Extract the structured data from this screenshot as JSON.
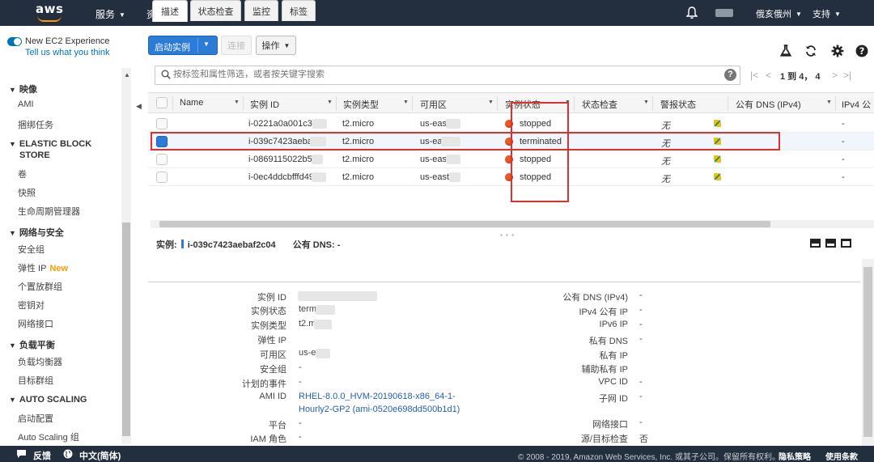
{
  "topnav": {
    "logo_text": "aws",
    "services": "服务",
    "resource_groups": "资源组",
    "user": "俄亥俄州",
    "support": "支持"
  },
  "sidebar": {
    "new_experience": "New EC2 Experience",
    "tell_us": "Tell us what you think",
    "items": [
      {
        "type": "head",
        "label": "映像"
      },
      {
        "type": "item",
        "label": "AMI"
      },
      {
        "type": "item",
        "label": "捆绑任务"
      },
      {
        "type": "head",
        "label": "ELASTIC BLOCK"
      },
      {
        "type": "head2",
        "label": "STORE"
      },
      {
        "type": "item",
        "label": "卷"
      },
      {
        "type": "item",
        "label": "快照"
      },
      {
        "type": "item",
        "label": "生命周期管理器"
      },
      {
        "type": "head",
        "label": "网络与安全"
      },
      {
        "type": "item",
        "label": "安全组"
      },
      {
        "type": "item",
        "label": "弹性 IP",
        "badge": "New"
      },
      {
        "type": "item",
        "label": "个置放群组"
      },
      {
        "type": "item",
        "label": "密钥对"
      },
      {
        "type": "item",
        "label": "网络接口"
      },
      {
        "type": "head",
        "label": "负载平衡"
      },
      {
        "type": "item",
        "label": "负载均衡器"
      },
      {
        "type": "item",
        "label": "目标群组"
      },
      {
        "type": "head",
        "label": "AUTO SCALING"
      },
      {
        "type": "item",
        "label": "启动配置"
      },
      {
        "type": "item",
        "label": "Auto Scaling 组"
      }
    ]
  },
  "toolbar": {
    "launch_label": "启动实例",
    "connect_label": "连接",
    "actions_label": "操作"
  },
  "search": {
    "placeholder": "按标签和属性筛选，或者按关键字搜索"
  },
  "pager": {
    "text": "1 到 4，  4"
  },
  "table": {
    "headers": {
      "name": "Name",
      "instance_id": "实例 ID",
      "instance_type": "实例类型",
      "az": "可用区",
      "state": "实例状态",
      "status_check": "状态检查",
      "alarm": "警报状态",
      "public_dns": "公有 DNS (IPv4)",
      "ipv4": "IPv4 公"
    },
    "rows": [
      {
        "id": "i-0221a0a001c3f6",
        "type": "t2.micro",
        "az": "us-east",
        "state": "stopped",
        "alarm": "无",
        "dns": "-",
        "selected": false
      },
      {
        "id": "i-039c7423aebaf",
        "type": "t2.micro",
        "az": "us-ea",
        "state": "terminated",
        "alarm": "无",
        "dns": "-",
        "selected": true
      },
      {
        "id": "i-0869115022b5",
        "type": "t2.micro",
        "az": "us-east",
        "state": "stopped",
        "alarm": "无",
        "dns": "-",
        "selected": false
      },
      {
        "id": "i-0ec4ddcbfffd49",
        "type": "t2.micro",
        "az": "us-east-",
        "state": "stopped",
        "alarm": "无",
        "dns": "-",
        "selected": false
      }
    ]
  },
  "details": {
    "instance_label": "实例:",
    "instance_id": "i-039c7423aebaf2c04",
    "public_dns_label": "公有 DNS:",
    "public_dns_value": "-",
    "tabs": [
      "描述",
      "状态检查",
      "监控",
      "标签"
    ],
    "left": [
      {
        "label": "实例 ID",
        "value": ""
      },
      {
        "label": "实例状态",
        "value": "term      ed"
      },
      {
        "label": "实例类型",
        "value": "t2.m"
      },
      {
        "label": "弹性 IP",
        "value": ""
      },
      {
        "label": "可用区",
        "value": "us-e     2c"
      },
      {
        "label": "安全组",
        "value": "-"
      },
      {
        "label": "计划的事件",
        "value": "-"
      },
      {
        "label": "AMI ID",
        "value": "RHEL-8.0.0_HVM-20190618-x86_64-1-"
      },
      {
        "label": "",
        "value": "Hourly2-GP2 (ami-0520e698dd500b1d1)"
      },
      {
        "label": "平台",
        "value": "-"
      },
      {
        "label": "IAM 角色",
        "value": "-"
      }
    ],
    "right": [
      {
        "label": "公有 DNS (IPv4)",
        "value": "-"
      },
      {
        "label": "IPv4 公有 IP",
        "value": "-"
      },
      {
        "label": "IPv6 IP",
        "value": "-"
      },
      {
        "label": "私有 DNS",
        "value": "-"
      },
      {
        "label": "私有 IP",
        "value": ""
      },
      {
        "label": "辅助私有 IP",
        "value": ""
      },
      {
        "label": "VPC ID",
        "value": "-"
      },
      {
        "label": "子网 ID",
        "value": "-"
      },
      {
        "label": "",
        "value": ""
      },
      {
        "label": "网络接口",
        "value": "-"
      },
      {
        "label": "源/目标检查",
        "value": "否"
      }
    ]
  },
  "footer": {
    "feedback": "反馈",
    "language": "中文(简体)",
    "copyright": "© 2008 - 2019, Amazon Web Services, Inc. 或其子公司。保留所有权利。",
    "privacy": "隐私策略",
    "terms": "使用条款"
  },
  "colors": {
    "nav_bg": "#232f3e",
    "primary": "#2b7bd8",
    "highlight": "#e0302e",
    "state_dot": "#e85a2a",
    "new_badge": "#ff9900"
  }
}
